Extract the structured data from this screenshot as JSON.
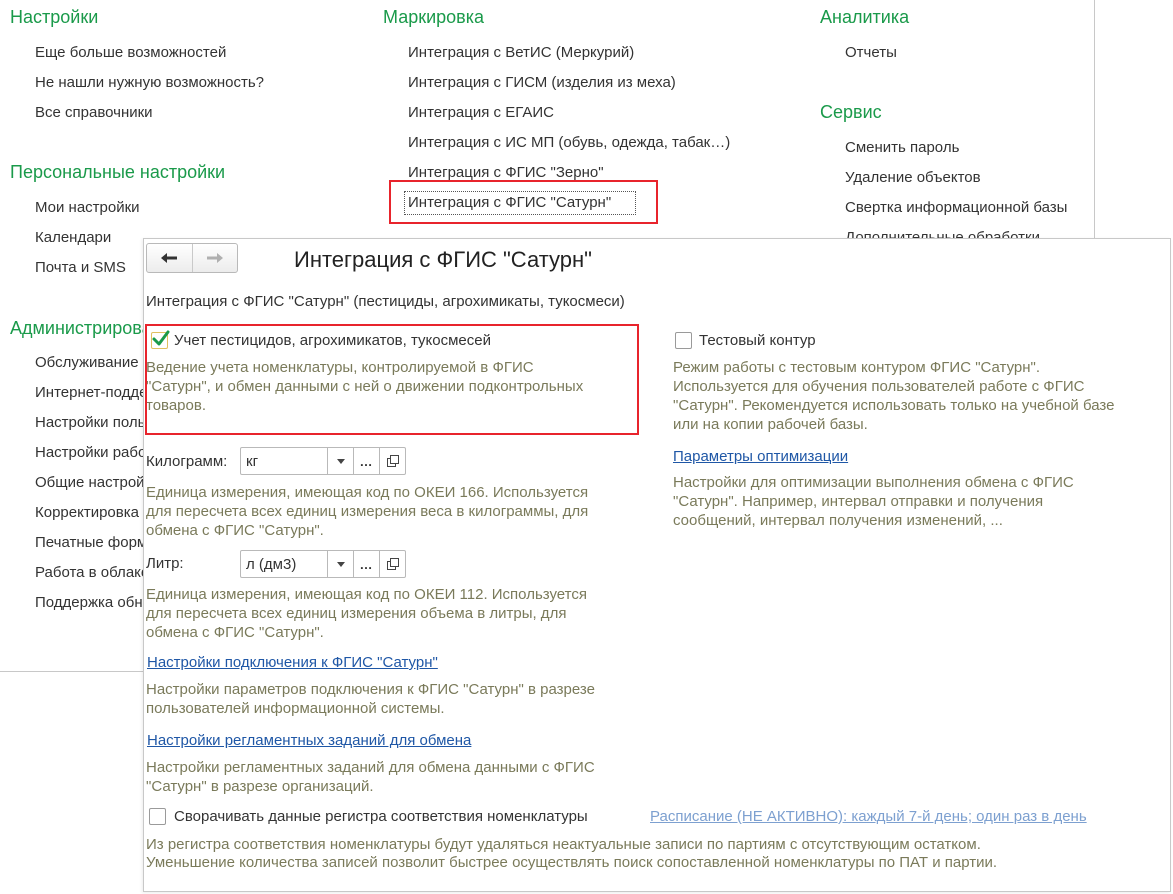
{
  "menu": {
    "settings": {
      "title": "Настройки",
      "items": [
        "Еще больше возможностей",
        "Не нашли нужную возможность?",
        "Все справочники"
      ]
    },
    "personal": {
      "title": "Персональные настройки",
      "items": [
        "Мои настройки",
        "Календари",
        "Почта и SMS"
      ]
    },
    "admin": {
      "title": "Администрирование",
      "items": [
        "Обслуживание",
        "Интернет-поддержка",
        "Настройки пользователей",
        "Настройки работы",
        "Общие настройки",
        "Корректировка",
        "Печатные формы",
        "Работа в облаке",
        "Поддержка обновления"
      ]
    },
    "marking": {
      "title": "Маркировка",
      "items": [
        "Интеграция с ВетИС (Меркурий)",
        "Интеграция с ГИСМ (изделия из меха)",
        "Интеграция с ЕГАИС",
        "Интеграция с ИС МП (обувь, одежда, табак…)",
        "Интеграция с ФГИС \"Зерно\"",
        "Интеграция с ФГИС \"Сатурн\""
      ]
    },
    "analytics": {
      "title": "Аналитика",
      "items": [
        "Отчеты"
      ]
    },
    "service": {
      "title": "Сервис",
      "items": [
        "Сменить пароль",
        "Удаление объектов",
        "Свертка информационной базы",
        "Дополнительные обработки"
      ]
    }
  },
  "dialog": {
    "title": "Интеграция с ФГИС \"Сатурн\"",
    "subtitle": "Интеграция с ФГИС \"Сатурн\" (пестициды, агрохимикаты, тукосмеси)",
    "accounting": {
      "label": "Учет пестицидов, агрохимикатов, тукосмесей",
      "checked": true,
      "desc": [
        "Ведение учета номенклатуры, контролируемой в ФГИС",
        "\"Сатурн\", и обмен данными с ней о движении подконтрольных",
        "товаров."
      ]
    },
    "test_contour": {
      "label": "Тестовый контур",
      "checked": false,
      "desc": [
        "Режим работы с тестовым контуром ФГИС \"Сатурн\".",
        "Используется для обучения пользователей работе с ФГИС",
        "\"Сатурн\". Рекомендуется использовать только на учебной базе",
        "или на копии рабочей базы."
      ]
    },
    "optimization": {
      "link": "Параметры оптимизации",
      "desc": [
        "Настройки для оптимизации выполнения обмена с ФГИС",
        "\"Сатурн\". Например, интервал отправки и получения",
        "сообщений, интервал получения изменений, ..."
      ]
    },
    "kilogram": {
      "label": "Килограмм:",
      "value": "кг",
      "desc": [
        "Единица измерения, имеющая код по ОКЕИ 166. Используется",
        "для пересчета всех единиц измерения веса в килограммы, для",
        "обмена с ФГИС \"Сатурн\"."
      ]
    },
    "liter": {
      "label": "Литр:",
      "value": "л (дм3)",
      "desc": [
        "Единица измерения, имеющая код по ОКЕИ 112. Используется",
        "для пересчета всех единиц измерения объема в литры, для",
        "обмена с ФГИС \"Сатурн\"."
      ]
    },
    "connection": {
      "link": "Настройки подключения к ФГИС \"Сатурн\"",
      "desc": [
        "Настройки параметров подключения к ФГИС \"Сатурн\" в разрезе",
        "пользователей информационной системы."
      ]
    },
    "scheduled": {
      "link": "Настройки регламентных заданий для обмена",
      "desc": [
        "Настройки регламентных заданий для обмена данными с ФГИС",
        "\"Сатурн\" в разрезе организаций."
      ]
    },
    "collapse": {
      "label": "Сворачивать данные регистра соответствия номенклатуры",
      "checked": false,
      "schedule_link": "Расписание (НЕ АКТИВНО): каждый 7-й день; один раз в день",
      "desc": [
        "Из регистра соответствия номенклатуры будут удаляться неактуальные записи по партиям с отсутствующим остатком.",
        "Уменьшение количества записей позволит быстрее осуществлять поиск сопоставленной номенклатуры по ПАТ и партии."
      ]
    }
  },
  "colors": {
    "section_title": "#1a9a4a",
    "link": "#1f57a6",
    "highlight": "#e8242c",
    "desc_text": "#7a7a5a"
  },
  "icons": [
    "back-arrow-icon",
    "forward-arrow-icon",
    "checkmark-icon",
    "dropdown-arrow-icon",
    "ellipsis-icon",
    "open-window-icon"
  ]
}
